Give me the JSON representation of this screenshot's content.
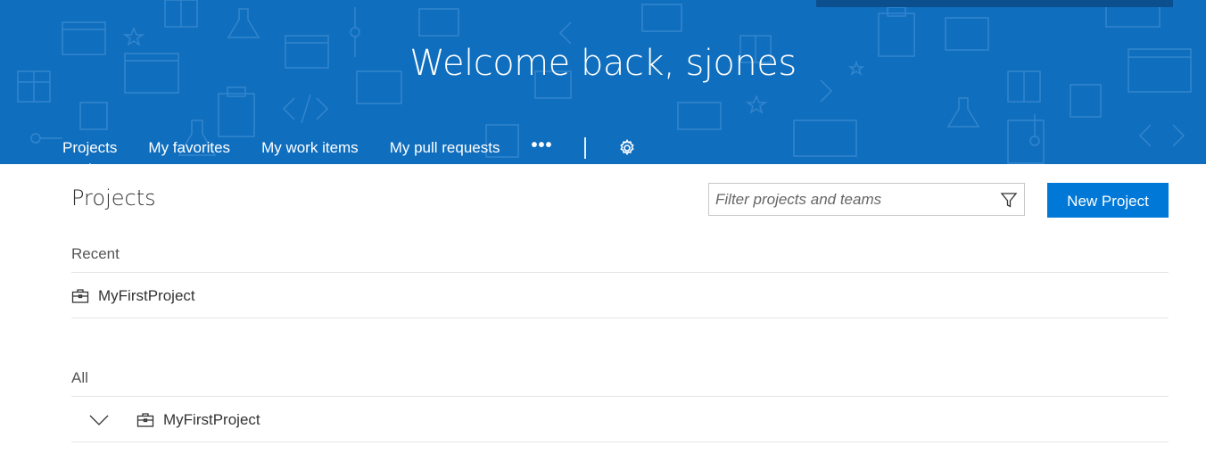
{
  "header": {
    "welcome": "Welcome back, sjones",
    "nav": [
      {
        "label": "Projects",
        "selected": true
      },
      {
        "label": "My favorites",
        "selected": false
      },
      {
        "label": "My work items",
        "selected": false
      },
      {
        "label": "My pull requests",
        "selected": false
      }
    ],
    "more_label": "•••",
    "settings_icon": "gear-icon",
    "banner_color": "#106ebe"
  },
  "main": {
    "title": "Projects",
    "filter": {
      "placeholder": "Filter projects and teams",
      "value": "",
      "icon": "filter-icon"
    },
    "new_project_label": "New Project",
    "recent": {
      "label": "Recent",
      "items": [
        {
          "name": "MyFirstProject",
          "icon": "briefcase-icon"
        }
      ]
    },
    "all": {
      "label": "All",
      "items": [
        {
          "name": "MyFirstProject",
          "icon": "briefcase-icon",
          "expand_icon": "chevron-down-icon"
        }
      ]
    },
    "accent_color": "#0078d7"
  }
}
